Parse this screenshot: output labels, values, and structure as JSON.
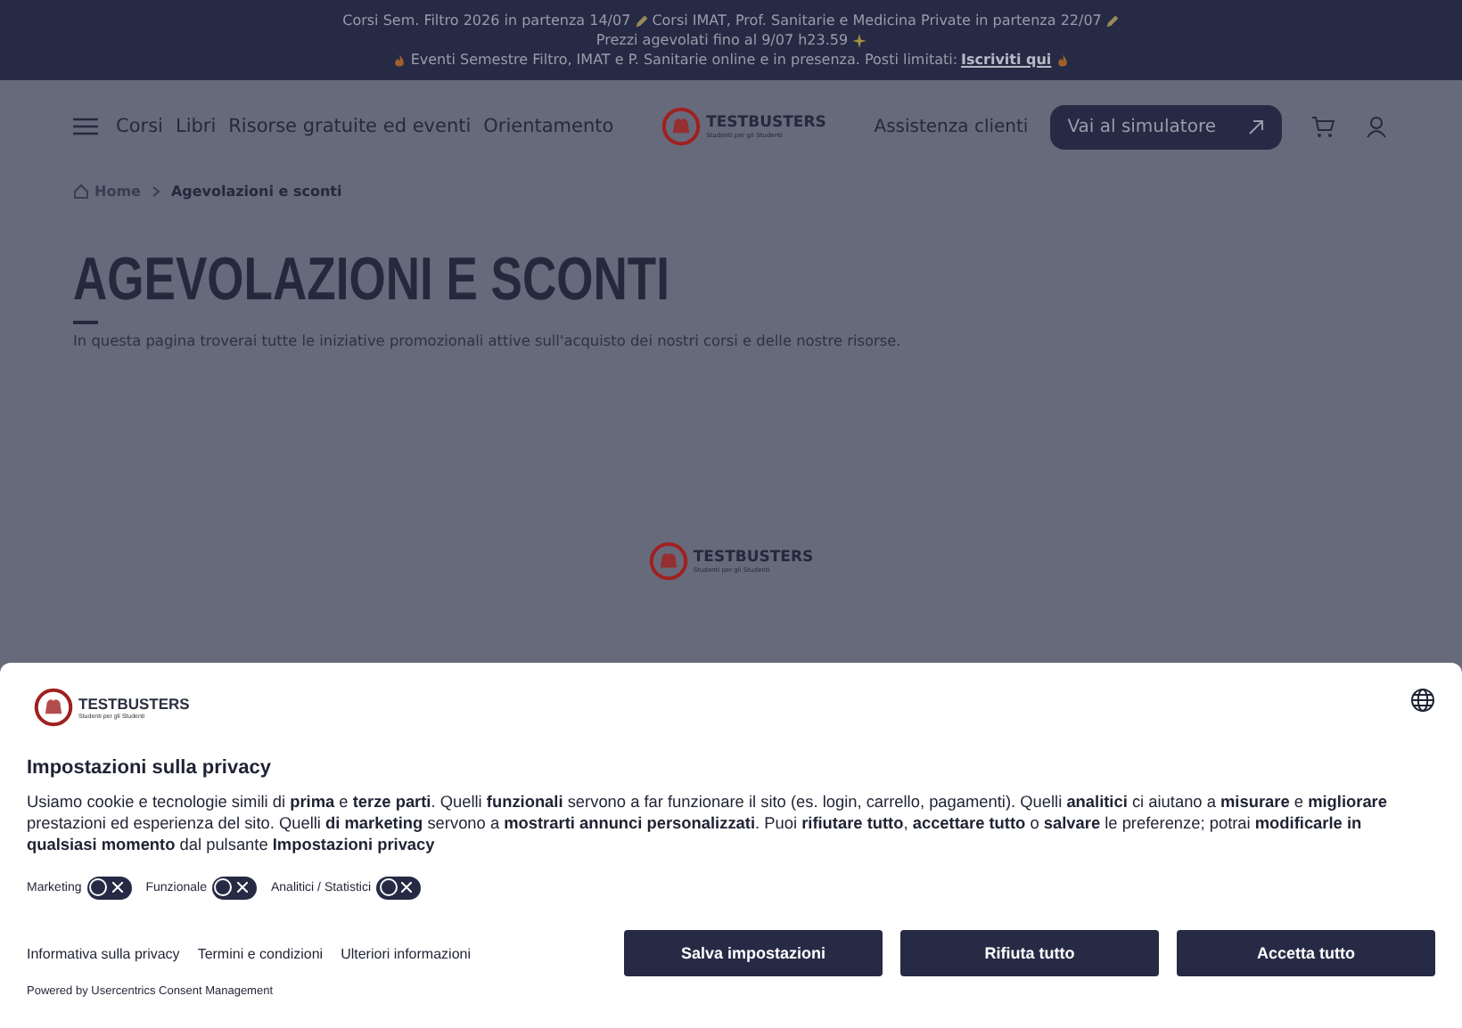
{
  "banner": {
    "line_1": "Corsi Sem. Filtro 2026 in partenza 14/07",
    "line_1b": "Corsi IMAT, Prof. Sanitarie e Medicina Private in partenza 22/07",
    "line_2": "Prezzi agevolati fino al 9/07 h23.59",
    "line_3": "Eventi Semestre Filtro, IMAT e P. Sanitarie online e in presenza. Posti limitati:",
    "line_3_link": "Iscriviti qui"
  },
  "nav": {
    "items": [
      "Corsi",
      "Libri",
      "Risorse gratuite ed eventi",
      "Orientamento"
    ],
    "logo": "TESTBUSTERS",
    "tagline": "Studenti per gli Studenti",
    "support": "Assistenza clienti",
    "cta": "Vai al simulatore"
  },
  "breadcrumb": [
    "Home",
    "Agevolazioni e sconti"
  ],
  "page": {
    "title": "AGEVOLAZIONI E SCONTI",
    "intro": "In questa pagina troverai tutte le iniziative promozionali attive sull'acquisto dei nostri corsi e delle nostre risorse.",
    "loader_logo": "TESTBUSTERS",
    "loader_tagline": "Studenti per gli Studenti"
  },
  "consent": {
    "logo": "TESTBUSTERS",
    "tagline": "Studenti per gli Studenti",
    "title": "Impostazioni sulla privacy",
    "text": "Usiamo cookie e tecnologie simili di **prima** e **terze parti**. Quelli **funzionali** servono a far funzionare il sito (es. login, carrello, pagamenti). Quelli **analitici** ci aiutano a **misurare** e **migliorare** prestazioni ed esperienza del sito. Quelli **di marketing** servono a **mostrarti annunci personalizzati**. Puoi **rifiutare tutto**, **accettare tutto** o **salvare** le preferenze; potrai **modificarle in qualsiasi momento** dal pulsante **Impostazioni privacy**",
    "toggles": [
      {
        "label": "Marketing",
        "checked": false
      },
      {
        "label": "Funzionale",
        "checked": false
      },
      {
        "label": "Analitici / Statistici",
        "checked": false
      }
    ],
    "links": [
      "Informativa sulla privacy",
      "Termini e condizioni",
      "Ulteriori informazioni"
    ],
    "powered": "Powered by Usercentrics Consent Management",
    "buttons": [
      "Salva impostazioni",
      "Rifiuta tutto",
      "Accetta tutto"
    ]
  }
}
